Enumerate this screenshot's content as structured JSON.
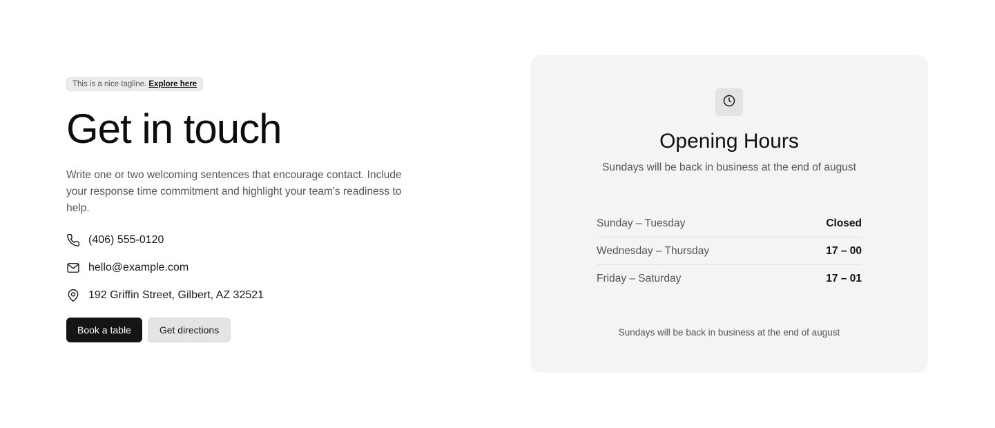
{
  "tagline": {
    "text": "This is a nice tagline.",
    "link": "Explore here"
  },
  "heading": "Get in touch",
  "intro": "Write one or two welcoming sentences that encourage contact. Include your response time commitment and highlight your team's readiness to help.",
  "contacts": [
    {
      "icon": "phone-icon",
      "text": "(406) 555-0120"
    },
    {
      "icon": "mail-icon",
      "text": "hello@example.com"
    },
    {
      "icon": "map-pin-icon",
      "text": "192 Griffin Street, Gilbert, AZ 32521"
    }
  ],
  "buttons": {
    "primary": "Book a table",
    "secondary": "Get directions"
  },
  "hours_card": {
    "icon": "clock-icon",
    "title": "Opening Hours",
    "subtitle": "Sundays will be back in business at the end of august",
    "rows": [
      {
        "day": "Sunday – Tuesday",
        "time": "Closed"
      },
      {
        "day": "Wednesday – Thursday",
        "time": "17 – 00"
      },
      {
        "day": "Friday – Saturday",
        "time": "17 – 01"
      }
    ],
    "footer": "Sundays will be back in business at the end of august"
  },
  "colors": {
    "background": "#ffffff",
    "card_background": "#f4f4f4",
    "primary_button": "#151515",
    "secondary_button": "#e4e4e4",
    "text_primary": "#111111",
    "text_muted": "#555555"
  }
}
